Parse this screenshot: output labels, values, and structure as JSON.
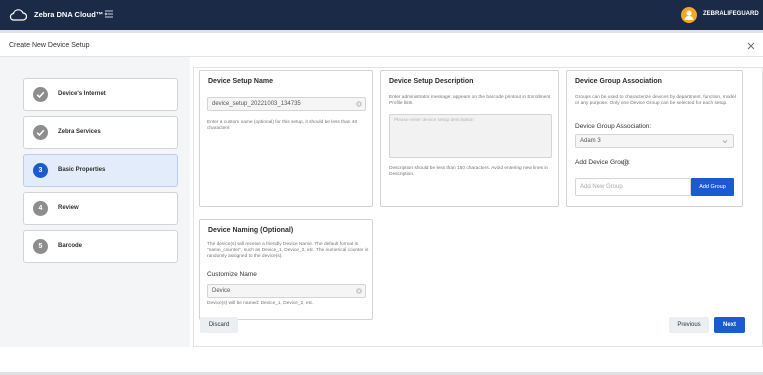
{
  "app": {
    "name": "Zebra DNA Cloud™",
    "user": "ZEBRALIFEGUARD"
  },
  "modal": {
    "title": "Create New Device Setup"
  },
  "steps": [
    {
      "number": "1",
      "label": "Device's Internet",
      "state": "done"
    },
    {
      "number": "2",
      "label": "Zebra Services",
      "state": "done"
    },
    {
      "number": "3",
      "label": "Basic Properties",
      "state": "active"
    },
    {
      "number": "4",
      "label": "Review",
      "state": "pending"
    },
    {
      "number": "5",
      "label": "Barcode",
      "state": "pending"
    }
  ],
  "setup_name": {
    "title": "Device Setup Name",
    "value": "device_setup_20221003_134735",
    "hint": "Enter a custom name (optional) for this setup, it should be less than 40 characters"
  },
  "setup_description": {
    "title": "Device Setup Description",
    "intro": "Enter administrator message; appears on the barcode printout in Enrollment Profile lists.",
    "placeholder": "Please enter device setup description",
    "hint": "Description should be less than 150 characters. Avoid entering new lines in Description."
  },
  "group_association": {
    "title": "Device Group Association",
    "intro": "Groups can be used to characterize devices by department, function, model or any purpose. Only one Device Group can be selected for each setup.",
    "select_label": "Device Group Association:",
    "selected": "Adam 3",
    "add_label": "Add Device Group:",
    "add_placeholder": "Add New Group",
    "add_button": "Add Group"
  },
  "device_naming": {
    "title": "Device Naming (Optional)",
    "intro": "The device(s) will receive a friendly Device Name. The default format is \"name_counter\", such as Device_1, Device_2, etc. The numerical counter is randomly assigned to the device(s).",
    "customize_label": "Customize Name",
    "value": "Device",
    "hint": "Device(s) will be named: Device_1, Device_2, etc."
  },
  "footer": {
    "discard": "Discard",
    "previous": "Previous",
    "next": "Next"
  },
  "colors": {
    "topbar": "#1b2a47",
    "accent": "#1a5ccf",
    "avatar": "#f5a623"
  }
}
